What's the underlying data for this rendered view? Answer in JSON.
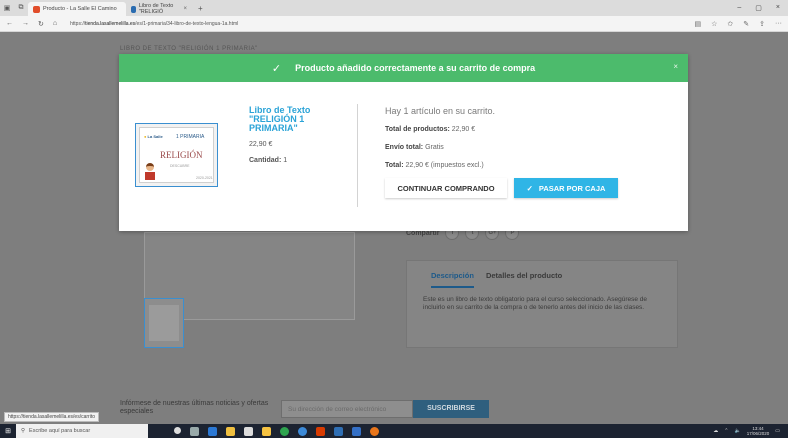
{
  "browser": {
    "tabs": [
      {
        "label": "Producto - La Salle El Camino",
        "active": true
      },
      {
        "label": "Libro de Texto \"RELIGIÓ",
        "active": false
      }
    ],
    "new_tab": "+",
    "url_prefix": "https://",
    "url_domain": "tienda.lasallemelilla.es",
    "url_path": "/es/1-primaria/34-libro-de-texto-lengua-1a.html"
  },
  "page": {
    "breadcrumb": "LIBRO DE TEXTO \"RELIGIÓN 1 PRIMARIA\"",
    "share_label": "Compartir",
    "tabs": {
      "description": "Descripción",
      "details": "Detalles del producto"
    },
    "description_text": "Este es un libro de texto obligatorio para el curso seleccionado. Asegúrese de incluirlo en su carrito de la compra o de tenerlo antes del inicio de las clases.",
    "newsletter_text": "Infórmese de nuestras últimas noticias y ofertas especiales",
    "newsletter_placeholder": "Su dirección de correo electrónico",
    "newsletter_button": "SUSCRIBIRSE",
    "status_url": "https://tienda.lasallemelilla.es/es/carrito"
  },
  "modal": {
    "title": "Producto añadido correctamente a su carrito de compra",
    "close": "×",
    "product": {
      "name": "Libro de Texto \"RELIGIÓN 1 PRIMARIA\"",
      "price": "22,90 €",
      "quantity_label": "Cantidad:",
      "quantity_value": "1",
      "cover_logo": "La Salle",
      "cover_grade": "1 PRIMARIA",
      "cover_subject": "RELIGIÓN",
      "cover_sub": "DESCUBRE",
      "cover_year": "2020-2021"
    },
    "cart": {
      "count_text": "Hay 1 artículo en su carrito.",
      "total_products_label": "Total de productos:",
      "total_products_value": "22,90 €",
      "shipping_label": "Envío total:",
      "shipping_value": "Gratis",
      "total_label": "Total:",
      "total_value": "22,90 € (impuestos excl.)"
    },
    "buttons": {
      "continue": "CONTINUAR COMPRANDO",
      "checkout": "PASAR POR CAJA"
    }
  },
  "taskbar": {
    "search_placeholder": "Escribe aquí para buscar",
    "time": "13:44",
    "date": "17/06/2020"
  },
  "colors": {
    "success": "#4cbb6c",
    "accent": "#2fb5e6",
    "link": "#2aa3d7"
  }
}
